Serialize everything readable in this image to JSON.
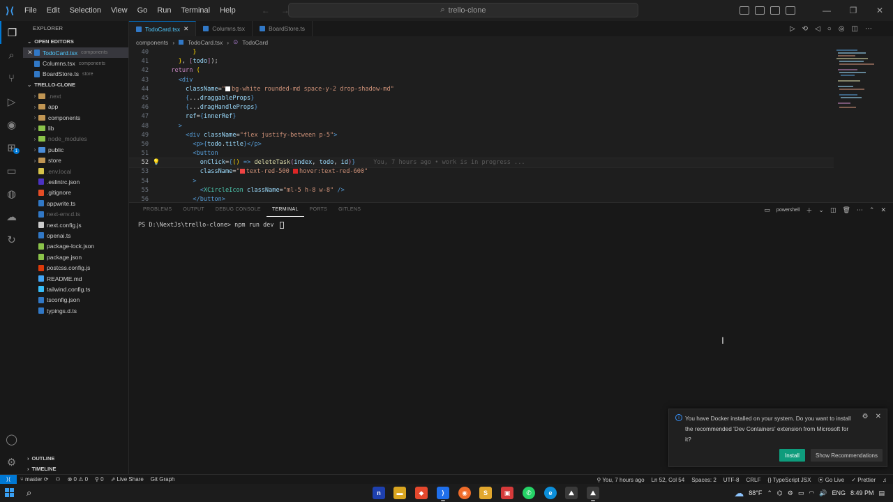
{
  "menu": [
    "File",
    "Edit",
    "Selection",
    "View",
    "Go",
    "Run",
    "Terminal",
    "Help"
  ],
  "search": {
    "text": "trello-clone"
  },
  "window": {
    "min": "—",
    "max": "❐",
    "close": "✕"
  },
  "sidebar": {
    "title": "EXPLORER",
    "open_editors_label": "OPEN EDITORS",
    "open_editors": [
      {
        "name": "TodoCard.tsx",
        "desc": "components",
        "active": true
      },
      {
        "name": "Columns.tsx",
        "desc": "components"
      },
      {
        "name": "BoardStore.ts",
        "desc": "store"
      }
    ],
    "project_label": "TRELLO-CLONE",
    "tree": [
      {
        "name": ".next",
        "kind": "folder",
        "dim": true
      },
      {
        "name": "app",
        "kind": "folder"
      },
      {
        "name": "components",
        "kind": "folder"
      },
      {
        "name": "lib",
        "kind": "folder"
      },
      {
        "name": "node_modules",
        "kind": "folder",
        "dim": true
      },
      {
        "name": "public",
        "kind": "folder"
      },
      {
        "name": "store",
        "kind": "folder"
      },
      {
        "name": ".env.local",
        "kind": "file",
        "dim": true
      },
      {
        "name": ".eslintrc.json",
        "kind": "file"
      },
      {
        "name": ".gitignore",
        "kind": "file"
      },
      {
        "name": "appwrite.ts",
        "kind": "file"
      },
      {
        "name": "next-env.d.ts",
        "kind": "file",
        "dim": true
      },
      {
        "name": "next.config.js",
        "kind": "file"
      },
      {
        "name": "openai.ts",
        "kind": "file"
      },
      {
        "name": "package-lock.json",
        "kind": "file"
      },
      {
        "name": "package.json",
        "kind": "file"
      },
      {
        "name": "postcss.config.js",
        "kind": "file"
      },
      {
        "name": "README.md",
        "kind": "file"
      },
      {
        "name": "tailwind.config.ts",
        "kind": "file"
      },
      {
        "name": "tsconfig.json",
        "kind": "file"
      },
      {
        "name": "typings.d.ts",
        "kind": "file"
      }
    ],
    "outline_label": "OUTLINE",
    "timeline_label": "TIMELINE"
  },
  "tabs": [
    {
      "label": "TodoCard.tsx",
      "active": true,
      "close": "✕"
    },
    {
      "label": "Columns.tsx",
      "active": false
    },
    {
      "label": "BoardStore.ts",
      "active": false
    }
  ],
  "breadcrumb": [
    "components",
    "TodoCard.tsx",
    "TodoCard"
  ],
  "code": {
    "line_numbers": [
      "40",
      "41",
      "42",
      "43",
      "44",
      "45",
      "46",
      "47",
      "48",
      "49",
      "50",
      "51",
      "52",
      "53",
      "54",
      "55",
      "56"
    ],
    "blame": "You, 7 hours ago • work is in progress ..."
  },
  "panel": {
    "tabs": [
      "PROBLEMS",
      "OUTPUT",
      "DEBUG CONSOLE",
      "TERMINAL",
      "PORTS",
      "GITLENS"
    ],
    "active_tab": "TERMINAL",
    "shell": "powershell",
    "prompt": "PS D:\\NextJs\\trello-clone> npm run dev "
  },
  "notification": {
    "message": "You have Docker installed on your system. Do you want to install the recommended 'Dev Containers' extension from Microsoft for it?",
    "install": "Install",
    "show_recommendations": "Show Recommendations"
  },
  "statusbar": {
    "branch": "master",
    "problems": "⊗ 0 ⚠ 0",
    "ports": "0",
    "live_share": "Live Share",
    "git_graph": "Git Graph",
    "blame": "You, 7 hours ago",
    "position": "Ln 52, Col 54",
    "spaces": "Spaces: 2",
    "encoding": "UTF-8",
    "eol": "CRLF",
    "language": "TypeScript JSX",
    "go_live": "Go Live",
    "prettier": "Prettier"
  },
  "taskbar": {
    "temperature": "88°F",
    "language": "ENG",
    "time": "8:49 PM"
  },
  "colors": {
    "accent": "#0078d4",
    "install_button": "#0e9c7c"
  }
}
